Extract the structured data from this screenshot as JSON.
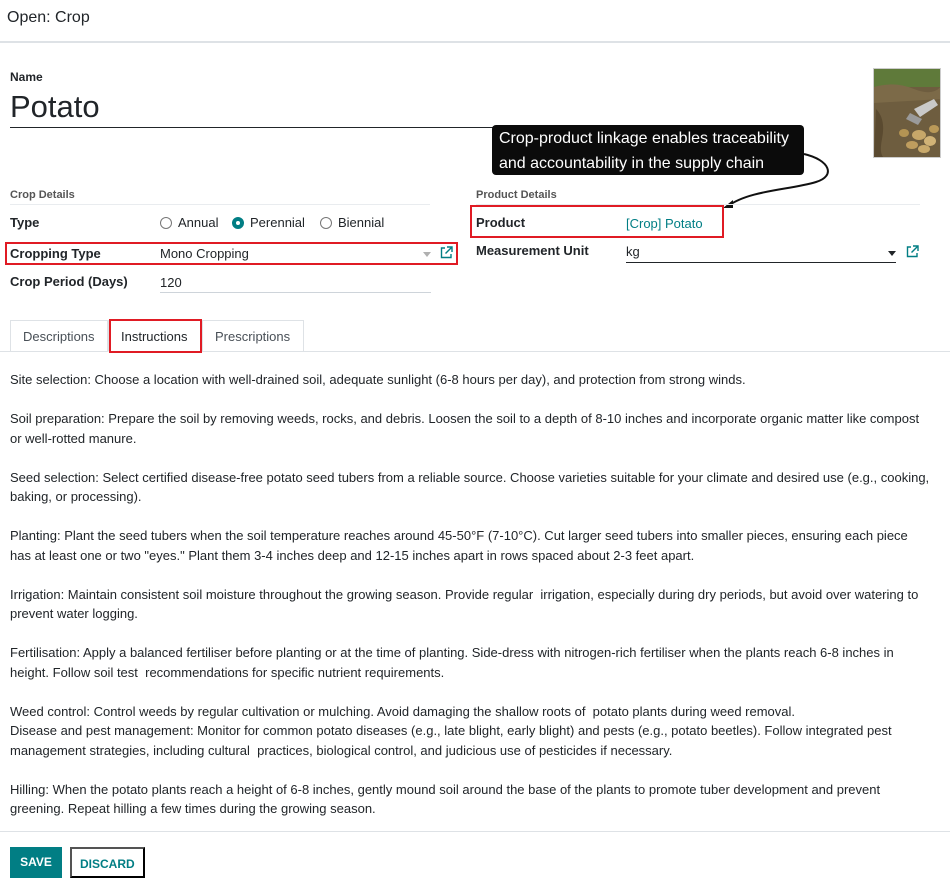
{
  "dialog": {
    "title": "Open: Crop"
  },
  "name": {
    "label": "Name",
    "value": "Potato"
  },
  "tooltip": {
    "line1": "Crop-product linkage enables traceability",
    "line2": "and accountability in the supply chain"
  },
  "crop_details": {
    "title": "Crop Details",
    "type_label": "Type",
    "type_options": [
      "Annual",
      "Perennial",
      "Biennial"
    ],
    "type_selected": "Perennial",
    "cropping_type_label": "Cropping Type",
    "cropping_type_value": "Mono Cropping",
    "crop_period_label": "Crop Period (Days)",
    "crop_period_value": "120"
  },
  "product_details": {
    "title": "Product Details",
    "product_label": "Product",
    "product_value": "[Crop] Potato",
    "uom_label": "Measurement Unit",
    "uom_value": "kg"
  },
  "tabs": [
    {
      "label": "Descriptions",
      "active": false
    },
    {
      "label": "Instructions",
      "active": true
    },
    {
      "label": "Prescriptions",
      "active": false
    }
  ],
  "instructions": {
    "site": "Site selection: Choose a location with well-drained soil, adequate sunlight (6-8 hours per day), and protection from strong winds.",
    "soil": "Soil preparation: Prepare the soil by removing weeds, rocks, and debris. Loosen the soil to a depth of 8-10 inches and incorporate organic matter like compost or well-rotted manure.",
    "seed": "Seed selection: Select certified disease-free potato seed tubers from a reliable source. Choose varieties suitable for your climate and desired use (e.g., cooking, baking, or processing).",
    "planting": "Planting: Plant the seed tubers when the soil temperature reaches around 45-50°F (7-10°C). Cut larger seed tubers into smaller pieces, ensuring each piece has at least one or two \"eyes.\" Plant them 3-4 inches deep and 12-15 inches apart in rows spaced about 2-3 feet apart.",
    "irrigation": "Irrigation: Maintain consistent soil moisture throughout the growing season. Provide regular  irrigation, especially during dry periods, but avoid over watering to prevent water logging.",
    "fertilisation": "Fertilisation: Apply a balanced fertiliser before planting or at the time of planting. Side-dress with nitrogen-rich fertiliser when the plants reach 6-8 inches in height. Follow soil test  recommendations for specific nutrient requirements.",
    "weed": "Weed control: Control weeds by regular cultivation or mulching. Avoid damaging the shallow roots of  potato plants during weed removal.",
    "disease": "Disease and pest management: Monitor for common potato diseases (e.g., late blight, early blight) and pests (e.g., potato beetles). Follow integrated pest management strategies, including cultural  practices, biological control, and judicious use of pesticides if necessary.",
    "hilling": "Hilling: When the potato plants reach a height of 6-8 inches, gently mound soil around the base of the plants to promote tuber development and prevent greening. Repeat hilling a few times during the growing season."
  },
  "footer": {
    "save_label": "SAVE",
    "discard_label": "DISCARD"
  },
  "colors": {
    "accent": "#017e84",
    "highlight": "#e01b24"
  }
}
